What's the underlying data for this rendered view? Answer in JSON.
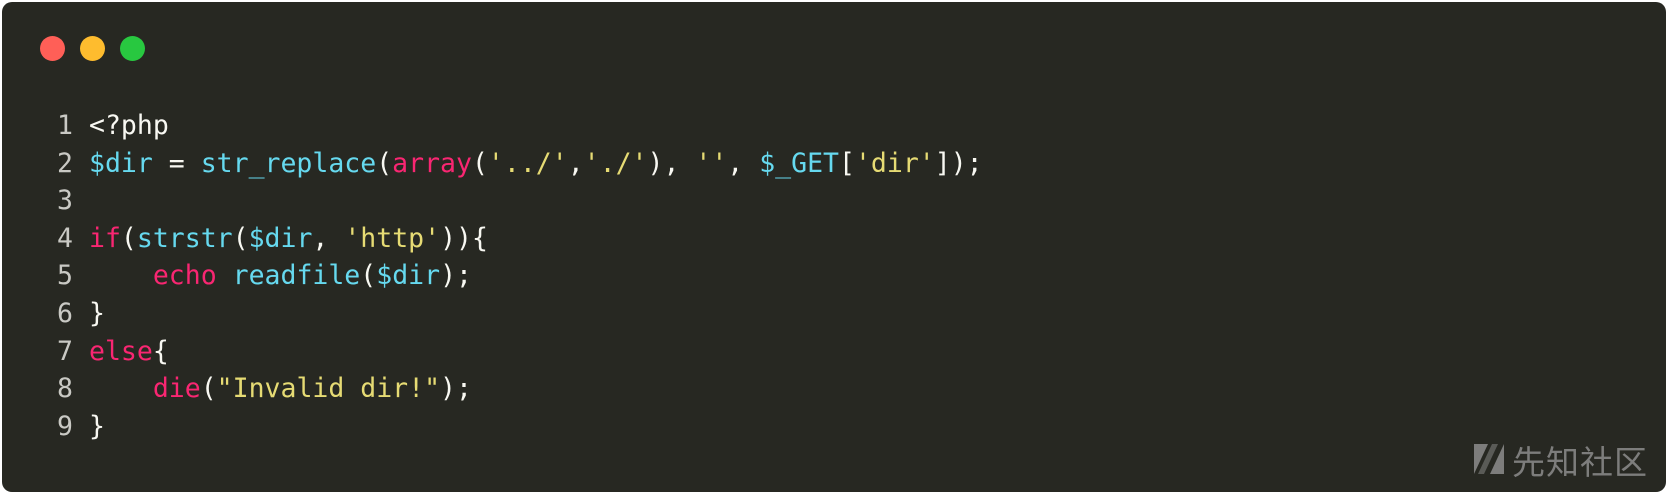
{
  "window": {
    "buttons": {
      "close_color": "#ff5f57",
      "minimize_color": "#febc2e",
      "maximize_color": "#28c840"
    }
  },
  "editor": {
    "language": "php",
    "colors": {
      "background": "#272822",
      "keyword": "#f92672",
      "function": "#66d9ef",
      "string": "#e6db74",
      "text": "#f8f8f2"
    },
    "lines": [
      {
        "num": "1",
        "tokens": [
          {
            "t": "plain",
            "v": "<?php"
          }
        ]
      },
      {
        "num": "2",
        "tokens": [
          {
            "t": "var",
            "v": "$dir"
          },
          {
            "t": "plain",
            "v": " = "
          },
          {
            "t": "fn",
            "v": "str_replace"
          },
          {
            "t": "plain",
            "v": "("
          },
          {
            "t": "kw",
            "v": "array"
          },
          {
            "t": "plain",
            "v": "("
          },
          {
            "t": "str",
            "v": "'../'"
          },
          {
            "t": "plain",
            "v": ","
          },
          {
            "t": "str",
            "v": "'./'"
          },
          {
            "t": "plain",
            "v": "), "
          },
          {
            "t": "str",
            "v": "''"
          },
          {
            "t": "plain",
            "v": ", "
          },
          {
            "t": "var",
            "v": "$_GET"
          },
          {
            "t": "plain",
            "v": "["
          },
          {
            "t": "str",
            "v": "'dir'"
          },
          {
            "t": "plain",
            "v": "]);"
          }
        ]
      },
      {
        "num": "3",
        "tokens": []
      },
      {
        "num": "4",
        "tokens": [
          {
            "t": "kw",
            "v": "if"
          },
          {
            "t": "plain",
            "v": "("
          },
          {
            "t": "fn",
            "v": "strstr"
          },
          {
            "t": "plain",
            "v": "("
          },
          {
            "t": "var",
            "v": "$dir"
          },
          {
            "t": "plain",
            "v": ", "
          },
          {
            "t": "str",
            "v": "'http'"
          },
          {
            "t": "plain",
            "v": ")){"
          }
        ]
      },
      {
        "num": "5",
        "tokens": [
          {
            "t": "plain",
            "v": "    "
          },
          {
            "t": "kw",
            "v": "echo"
          },
          {
            "t": "plain",
            "v": " "
          },
          {
            "t": "fn",
            "v": "readfile"
          },
          {
            "t": "plain",
            "v": "("
          },
          {
            "t": "var",
            "v": "$dir"
          },
          {
            "t": "plain",
            "v": ");"
          }
        ]
      },
      {
        "num": "6",
        "tokens": [
          {
            "t": "plain",
            "v": "}"
          }
        ]
      },
      {
        "num": "7",
        "tokens": [
          {
            "t": "kw",
            "v": "else"
          },
          {
            "t": "plain",
            "v": "{"
          }
        ]
      },
      {
        "num": "8",
        "tokens": [
          {
            "t": "plain",
            "v": "    "
          },
          {
            "t": "kw",
            "v": "die"
          },
          {
            "t": "plain",
            "v": "("
          },
          {
            "t": "str",
            "v": "\"Invalid dir!\""
          },
          {
            "t": "plain",
            "v": ");"
          }
        ]
      },
      {
        "num": "9",
        "tokens": [
          {
            "t": "plain",
            "v": "}"
          }
        ]
      }
    ]
  },
  "watermark": {
    "text": "先知社区",
    "icon": "xianzhi-logo-icon"
  }
}
